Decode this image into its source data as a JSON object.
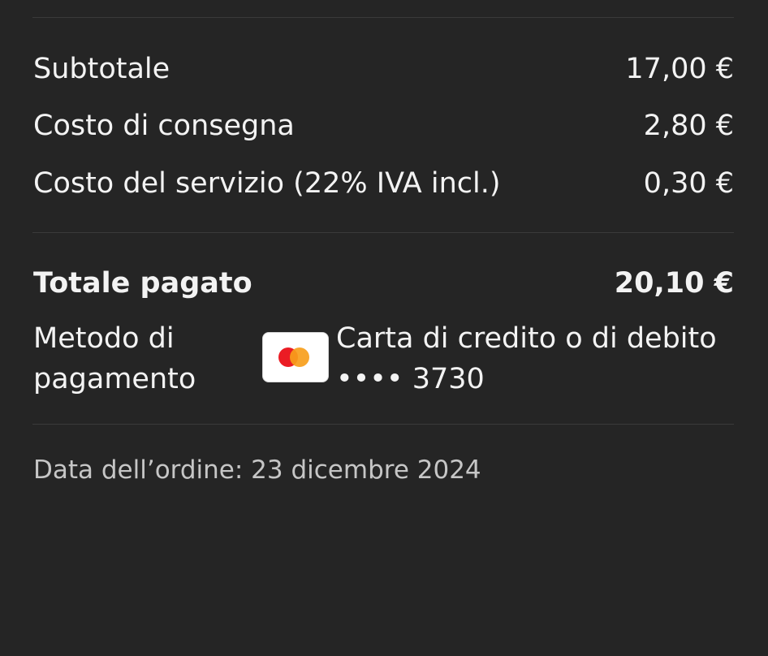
{
  "summary": {
    "subtotal": {
      "label": "Subtotale",
      "value": "17,00 €"
    },
    "delivery": {
      "label": "Costo di consegna",
      "value": "2,80 €"
    },
    "service": {
      "label": "Costo del servizio (22% IVA incl.)",
      "value": "0,30 €"
    }
  },
  "total": {
    "label": "Totale pagato",
    "value": "20,10 €"
  },
  "payment": {
    "label_line1": "Metodo di",
    "label_line2": "pagamento",
    "card_icon": "mastercard-icon",
    "method": "Carta di credito o di debito",
    "card_number": "•••• 3730",
    "card_colors": {
      "left": "#eb1c24",
      "right": "#f79e1b"
    }
  },
  "order_date": "Data dell’ordine: 23 dicembre 2024",
  "colors": {
    "background": "#252525",
    "text": "#f3f3f3",
    "muted_text": "#c6c6c6",
    "divider": "#3a3a3a"
  }
}
